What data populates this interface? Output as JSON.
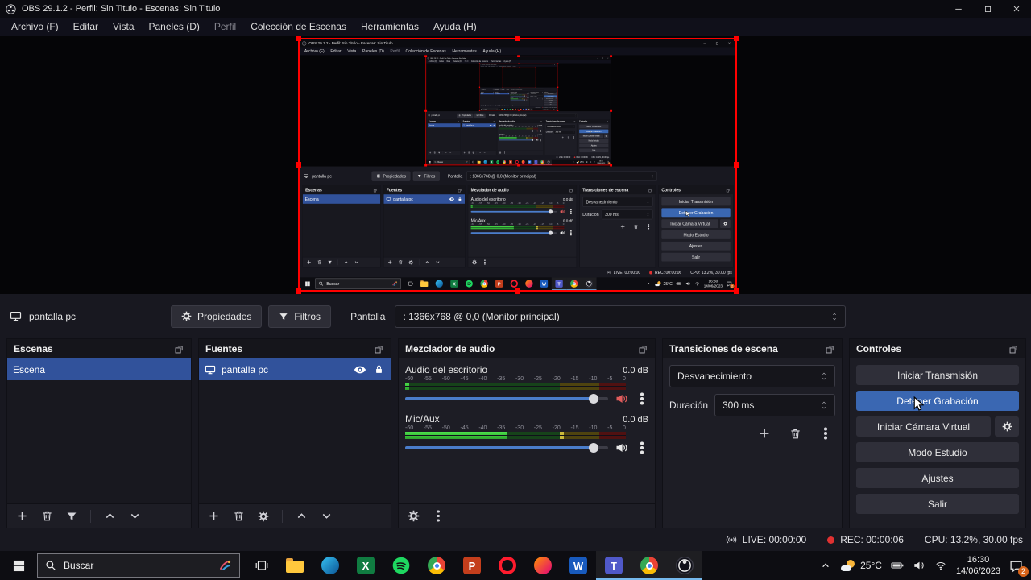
{
  "window": {
    "title": "OBS 29.1.2 - Perfil: Sin Titulo - Escenas: Sin Titulo"
  },
  "menu": {
    "items": [
      "Archivo (F)",
      "Editar",
      "Vista",
      "Paneles (D)",
      "Perfil",
      "Colección de Escenas",
      "Herramientas",
      "Ayuda (H)"
    ]
  },
  "context_bar": {
    "source_name": "pantalla pc",
    "properties_label": "Propiedades",
    "filters_label": "Filtros",
    "display_label": "Pantalla",
    "display_value": ": 1366x768 @ 0,0 (Monitor principal)"
  },
  "docks": {
    "scenes": {
      "title": "Escenas",
      "items": [
        "Escena"
      ]
    },
    "sources": {
      "title": "Fuentes",
      "items": [
        "pantalla pc"
      ]
    },
    "mixer": {
      "title": "Mezclador de audio",
      "ticks": [
        "-60",
        "-55",
        "-50",
        "-45",
        "-40",
        "-35",
        "-30",
        "-25",
        "-20",
        "-15",
        "-10",
        "-5",
        "0"
      ],
      "channels": [
        {
          "name": "Audio del escritorio",
          "db": "0.0 dB",
          "level_pct": 2,
          "volume_pct": 93,
          "muted": true
        },
        {
          "name": "Mic/Aux",
          "db": "0.0 dB",
          "level_pct": 46,
          "volume_pct": 93,
          "muted": false,
          "peak_pct": 70
        }
      ]
    },
    "transitions": {
      "title": "Transiciones de escena",
      "selected": "Desvanecimiento",
      "duration_label": "Duración",
      "duration_value": "300 ms"
    },
    "controls": {
      "title": "Controles",
      "stream": "Iniciar Transmisión",
      "record": "Detener Grabación",
      "vcam": "Iniciar Cámara Virtual",
      "studio": "Modo Estudio",
      "settings": "Ajustes",
      "exit": "Salir"
    }
  },
  "status_bar": {
    "live": "LIVE: 00:00:00",
    "rec": "REC: 00:00:06",
    "cpu": "CPU: 13.2%, 30.00 fps"
  },
  "taskbar": {
    "search_placeholder": "Buscar",
    "apps": [
      {
        "name": "file-explorer",
        "kind": "folder"
      },
      {
        "name": "edge",
        "kind": "gradient-circle",
        "c1": "#35c1f1",
        "c2": "#0b5394"
      },
      {
        "name": "excel",
        "kind": "letter-square",
        "bg": "#107c41",
        "letter": "X"
      },
      {
        "name": "spotify",
        "kind": "spotify"
      },
      {
        "name": "chrome",
        "kind": "chrome"
      },
      {
        "name": "powerpoint",
        "kind": "letter-square",
        "bg": "#c43e1c",
        "letter": "P"
      },
      {
        "name": "opera",
        "kind": "ring",
        "bg": "#ff1b2d"
      },
      {
        "name": "firefox",
        "kind": "gradient-circle",
        "c1": "#ff9400",
        "c2": "#e3007b"
      },
      {
        "name": "word",
        "kind": "letter-square",
        "bg": "#185abd",
        "letter": "W"
      },
      {
        "name": "teams",
        "kind": "letter-square",
        "bg": "#5059c9",
        "letter": "T",
        "open": true
      },
      {
        "name": "chrome-2",
        "kind": "chrome",
        "open": true
      },
      {
        "name": "obs",
        "kind": "obs",
        "open": true
      }
    ],
    "tray": {
      "temperature": "25°C",
      "time": "16:30",
      "date": "14/06/2023",
      "notification_count": "2"
    }
  },
  "icons": {
    "properties": "gear",
    "filters": "funnel",
    "add": "plus",
    "remove": "trash",
    "move_up": "chevron-up",
    "move_down": "chevron-down",
    "visibility": "eye",
    "lock": "padlock",
    "mute": "speaker",
    "menu_more": "kebab-dots",
    "live": "broadcast-antenna",
    "rec": "red-dot",
    "start": "windows-logo",
    "search": "magnifier",
    "notification": "chat-bubble"
  },
  "colors": {
    "accent_blue": "#3a67b2",
    "selection_blue": "#31529b",
    "selection_red": "#ff0000",
    "rec_indicator": "#e03131",
    "meter_green": "#3fd23f"
  }
}
